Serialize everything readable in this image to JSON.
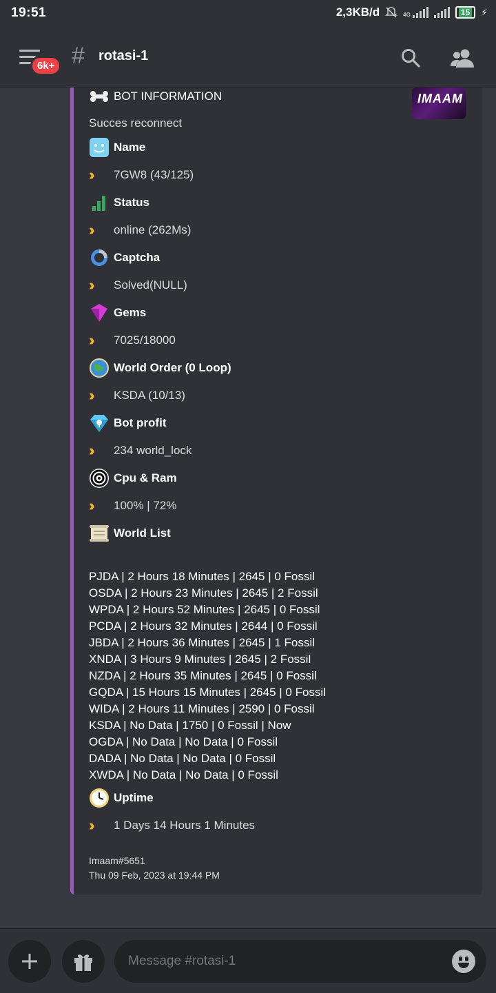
{
  "status_bar": {
    "time": "19:51",
    "net_speed": "2,3KB/d",
    "net_type": "4G",
    "battery": "15"
  },
  "header": {
    "badge": "6k+",
    "channel": "rotasi-1"
  },
  "embed": {
    "accent_color": "#9b59b6",
    "title": "BOT INFORMATION",
    "description": "Succes reconnect",
    "thumbnail_text": "IMAAM",
    "fields": [
      {
        "icon": "smiley-face-icon",
        "name": "Name",
        "value": "7GW8 (43/125)"
      },
      {
        "icon": "signal-bars-icon",
        "name": "Status",
        "value": "online (262Ms)"
      },
      {
        "icon": "captcha-icon",
        "name": "Captcha",
        "value": "Solved(NULL)"
      },
      {
        "icon": "gem-icon",
        "name": "Gems",
        "value": "7025/18000"
      },
      {
        "icon": "globe-icon",
        "name": "World Order (0 Loop)",
        "value": "KSDA (10/13)"
      },
      {
        "icon": "diamond-lock-icon",
        "name": "Bot profit",
        "value": "234 world_lock"
      },
      {
        "icon": "ubisoft-swirl-icon",
        "name": "Cpu & Ram",
        "value": "100% | 72%"
      }
    ],
    "world_list_title": "World List",
    "world_list": [
      "PJDA | 2 Hours 18 Minutes | 2645 | 0 Fossil",
      "OSDA | 2 Hours 23 Minutes | 2645 | 2 Fossil",
      "WPDA | 2 Hours 52 Minutes | 2645 | 0 Fossil",
      "PCDA | 2 Hours 32 Minutes | 2644 | 0 Fossil",
      "JBDA | 2 Hours 36 Minutes | 2645 | 1 Fossil",
      "XNDA | 3 Hours 9 Minutes | 2645 | 2 Fossil",
      "NZDA | 2 Hours 35 Minutes | 2645 | 0 Fossil",
      "GQDA | 15 Hours 15 Minutes | 2645 | 0 Fossil",
      "WIDA | 2 Hours 11 Minutes | 2590 | 0 Fossil",
      "KSDA | No Data | 1750 | 0 Fossil | Now",
      "OGDA | No Data | No Data | 0 Fossil",
      "DADA | No Data | No Data | 0 Fossil",
      "XWDA | No Data | No Data | 0 Fossil"
    ],
    "uptime_name": "Uptime",
    "uptime_value": "1 Days 14 Hours 1 Minutes",
    "footer_author": "Imaam#5651",
    "footer_time": "Thu 09 Feb, 2023 at 19:44 PM"
  },
  "composer": {
    "placeholder": "Message #rotasi-1"
  }
}
